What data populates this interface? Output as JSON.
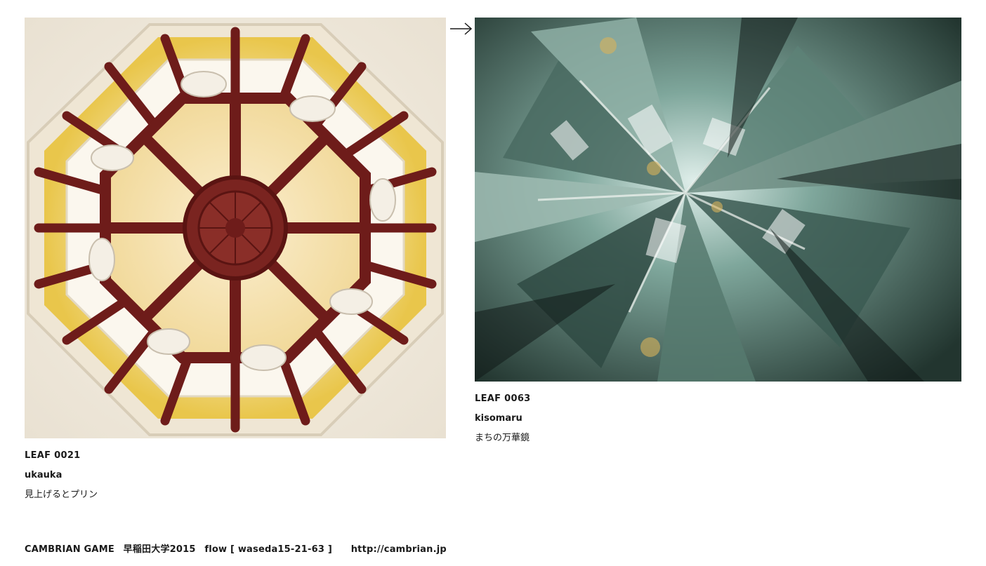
{
  "items": [
    {
      "leaf_id": "LEAF 0021",
      "author": "ukauka",
      "title": "見上げるとプリン"
    },
    {
      "leaf_id": "LEAF 0063",
      "author": "kisomaru",
      "title": "まちの万華鏡"
    }
  ],
  "navigation": {
    "arrow_icon": "right-arrow-icon"
  },
  "footer": {
    "brand": "CAMBRIAN GAME",
    "school": "早稲田大学2015",
    "flow": "flow [ waseda15-21-63 ]",
    "url": "http://cambrian.jp"
  },
  "colors": {
    "dome_brown": "#6e1c1a",
    "dome_yellow": "#f2d68a",
    "kaleido_green": "#3a5a52"
  }
}
